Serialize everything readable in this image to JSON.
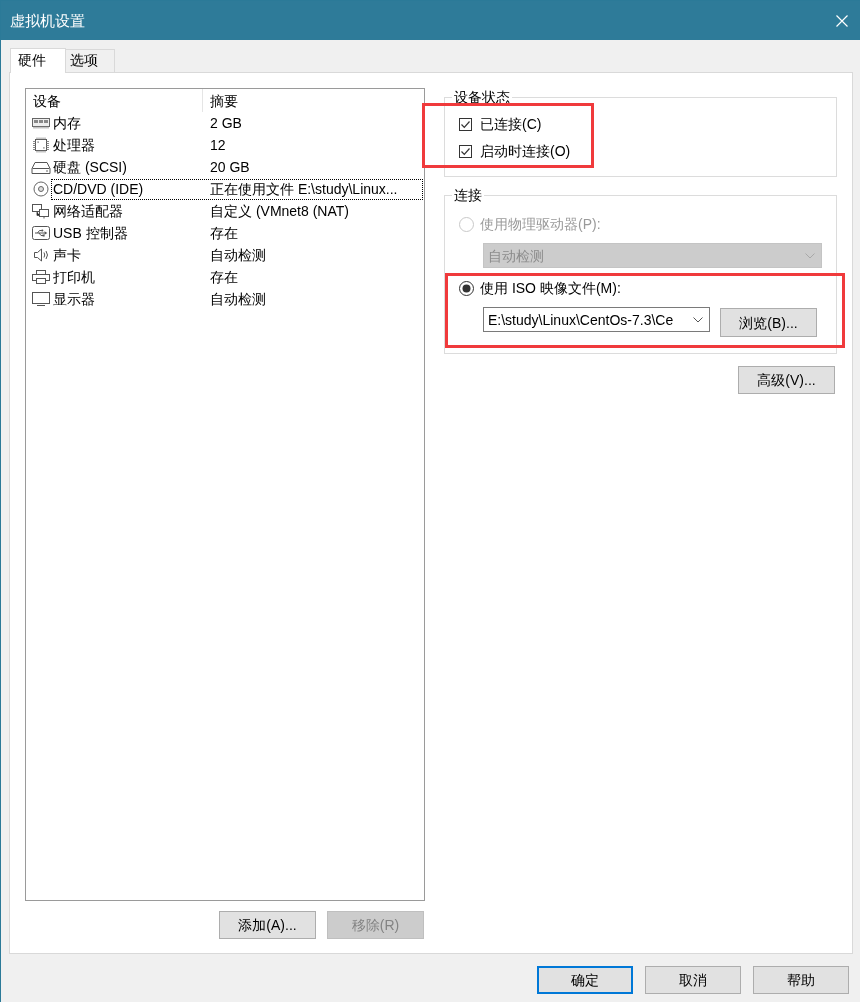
{
  "window": {
    "title": "虚拟机设置"
  },
  "tabs": [
    {
      "label": "硬件",
      "selected": true
    },
    {
      "label": "选项",
      "selected": false
    }
  ],
  "device_list": {
    "columns": [
      "设备",
      "摘要"
    ],
    "rows": [
      {
        "kind": "memory",
        "device": "内存",
        "summary": "2 GB",
        "selected": false
      },
      {
        "kind": "processor",
        "device": "处理器",
        "summary": "12",
        "selected": false
      },
      {
        "kind": "disk",
        "device": "硬盘 (SCSI)",
        "summary": "20 GB",
        "selected": false
      },
      {
        "kind": "cdrom",
        "device": "CD/DVD (IDE)",
        "summary": "正在使用文件 E:\\study\\Linux...",
        "selected": true
      },
      {
        "kind": "network",
        "device": "网络适配器",
        "summary": "自定义 (VMnet8 (NAT)",
        "selected": false
      },
      {
        "kind": "usb",
        "device": "USB 控制器",
        "summary": "存在",
        "selected": false
      },
      {
        "kind": "sound",
        "device": "声卡",
        "summary": "自动检测",
        "selected": false
      },
      {
        "kind": "printer",
        "device": "打印机",
        "summary": "存在",
        "selected": false
      },
      {
        "kind": "display",
        "device": "显示器",
        "summary": "自动检测",
        "selected": false
      }
    ]
  },
  "list_buttons": [
    {
      "label": "添加(A)...",
      "disabled": false
    },
    {
      "label": "移除(R)",
      "disabled": true
    }
  ],
  "device_status": {
    "title": "设备状态",
    "highlighted": true,
    "checkboxes": [
      {
        "label": "已连接(C)",
        "checked": true
      },
      {
        "label": "启动时连接(O)",
        "checked": true
      }
    ]
  },
  "connection": {
    "title": "连接",
    "options": [
      {
        "label": "使用物理驱动器(P):",
        "selected": false,
        "disabled": true,
        "field": {
          "kind": "dropdown",
          "value": "自动检测"
        }
      },
      {
        "label": "使用 ISO 映像文件(M):",
        "selected": true,
        "disabled": false,
        "highlighted": true,
        "field": {
          "kind": "combo",
          "value": "E:\\study\\Linux\\CentOs-7.3\\Ce"
        },
        "button": "浏览(B)..."
      }
    ]
  },
  "advanced_button": "高级(V)...",
  "dialog_buttons": [
    {
      "label": "确定",
      "default": true
    },
    {
      "label": "取消",
      "default": false
    },
    {
      "label": "帮助",
      "default": false
    }
  ]
}
